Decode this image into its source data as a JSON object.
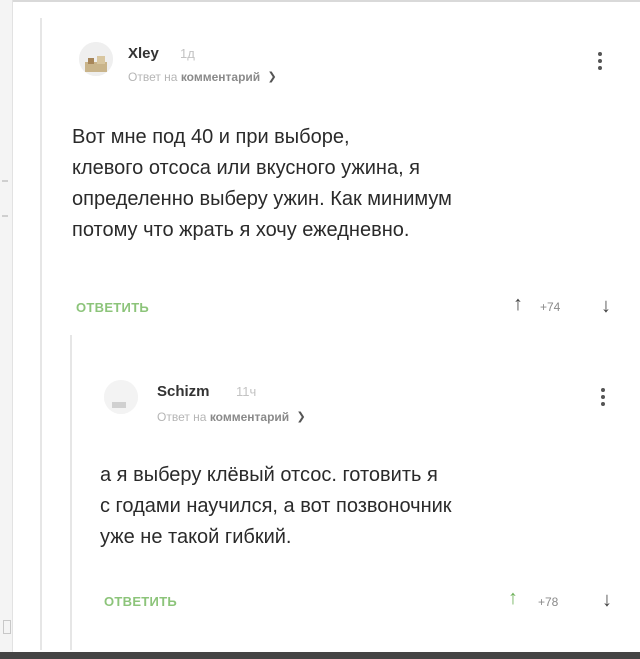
{
  "comments": [
    {
      "username": "Xley",
      "time": "1д",
      "reply_prefix": "Ответ на",
      "reply_target": "комментарий",
      "text": "Вот мне под 40 и при выборе,\nклевого отсоса или вкусного ужина, я\nопределенно выберу ужин. Как минимум\nпотому что жрать я хочу ежедневно.",
      "reply_label": "ОТВЕТИТЬ",
      "rating": "+74",
      "up_active": false
    },
    {
      "username": "Schizm",
      "time": "11ч",
      "reply_prefix": "Ответ на",
      "reply_target": "комментарий",
      "text": "а я выберу клёвый отсос.  готовить я\nс годами научился, а вот позвоночник\nуже не такой гибкий.",
      "reply_label": "ОТВЕТИТЬ",
      "rating": "+78",
      "up_active": true
    }
  ],
  "icons": {
    "chevron": "chevron-down-icon",
    "menu": "kebab-menu-icon",
    "up": "arrow-up-icon",
    "down": "arrow-down-icon"
  },
  "colors": {
    "reply_button": "#8cc47a",
    "upvote_active": "#6fb25a"
  }
}
